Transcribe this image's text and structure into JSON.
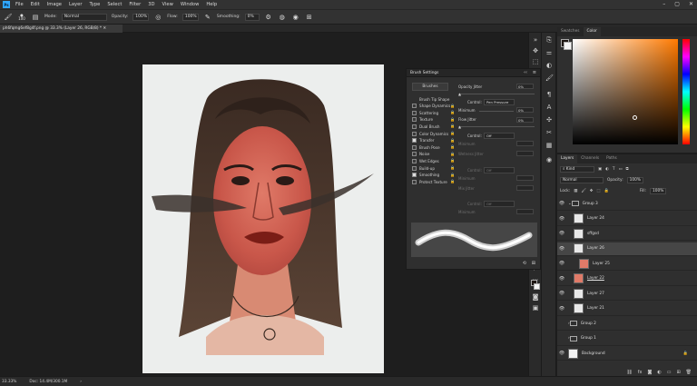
{
  "menubar": {
    "logo": "Ps",
    "items": [
      "File",
      "Edit",
      "Image",
      "Layer",
      "Type",
      "Select",
      "Filter",
      "3D",
      "View",
      "Window",
      "Help"
    ]
  },
  "options": {
    "brush_size": "100",
    "mode_label": "Mode:",
    "mode_value": "Normal",
    "opacity_label": "Opacity:",
    "opacity_value": "100%",
    "flow_label": "Flow:",
    "flow_value": "100%",
    "smoothing_label": "Smoothing:",
    "smoothing_value": "0%"
  },
  "document": {
    "tab_title": "ph6fqmg6ef8g4f.png @ 33.3% (Layer 26, RGB/8) *"
  },
  "brush_settings": {
    "title": "Brush Settings",
    "brushes_button": "Brushes",
    "items": [
      {
        "label": "Brush Tip Shape",
        "checkbox": false,
        "checked": false
      },
      {
        "label": "Shape Dynamics",
        "checkbox": true,
        "checked": false
      },
      {
        "label": "Scattering",
        "checkbox": true,
        "checked": false
      },
      {
        "label": "Texture",
        "checkbox": true,
        "checked": false
      },
      {
        "label": "Dual Brush",
        "checkbox": true,
        "checked": false
      },
      {
        "label": "Color Dynamics",
        "checkbox": true,
        "checked": false
      },
      {
        "label": "Transfer",
        "checkbox": true,
        "checked": true
      },
      {
        "label": "Brush Pose",
        "checkbox": true,
        "checked": false
      },
      {
        "label": "Noise",
        "checkbox": true,
        "checked": false
      },
      {
        "label": "Wet Edges",
        "checkbox": true,
        "checked": false
      },
      {
        "label": "Build-up",
        "checkbox": true,
        "checked": false
      },
      {
        "label": "Smoothing",
        "checkbox": true,
        "checked": true
      },
      {
        "label": "Protect Texture",
        "checkbox": true,
        "checked": false
      }
    ],
    "opacity_jitter_label": "Opacity Jitter",
    "opacity_jitter_value": "0%",
    "control_label": "Control:",
    "control_pen_pressure": "Pen Pressure",
    "minimum_label": "Minimum",
    "minimum_value": "0%",
    "flow_jitter_label": "Flow Jitter",
    "flow_jitter_value": "0%",
    "control_off": "Off",
    "minimum_label2": "Minimum",
    "wetness_jitter_label": "Wetness Jitter",
    "control_off2": "Off",
    "minimum_label3": "Minimum",
    "mix_jitter_label": "Mix Jitter",
    "control_off3": "Off",
    "minimum_label4": "Minimum"
  },
  "color_panel": {
    "tabs": [
      "Swatches",
      "Color"
    ],
    "hue_color": "#ff7a00"
  },
  "layers_panel": {
    "tabs": [
      "Layers",
      "Channels",
      "Paths"
    ],
    "kind_label": "Kind",
    "blend_mode": "Normal",
    "opacity_label": "Opacity:",
    "opacity_value": "100%",
    "lock_label": "Lock:",
    "fill_label": "Fill:",
    "fill_value": "100%",
    "layers": [
      {
        "name": "Group 3",
        "type": "group",
        "visible": true
      },
      {
        "name": "Layer 24",
        "type": "layer",
        "visible": true
      },
      {
        "name": "sffgsd",
        "type": "layer",
        "visible": true
      },
      {
        "name": "Layer 26",
        "type": "layer",
        "visible": true,
        "active": true
      },
      {
        "name": "Layer 25",
        "type": "layer",
        "visible": true
      },
      {
        "name": "Layer 22",
        "type": "layer",
        "visible": true
      },
      {
        "name": "Layer 27",
        "type": "layer",
        "visible": true
      },
      {
        "name": "Layer 21",
        "type": "layer",
        "visible": true
      },
      {
        "name": "Group 2",
        "type": "group",
        "visible": false
      },
      {
        "name": "Group 1",
        "type": "group",
        "visible": false
      },
      {
        "name": "Background",
        "type": "background",
        "visible": true
      }
    ]
  },
  "status": {
    "zoom": "33.33%",
    "doc_info": "Doc: 14.4M/300.1M"
  }
}
